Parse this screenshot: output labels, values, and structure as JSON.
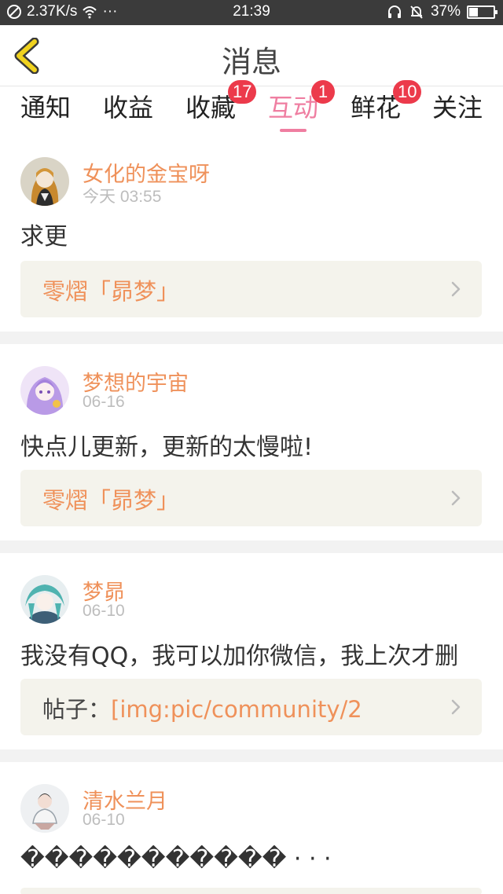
{
  "status_bar": {
    "net_speed": "2.37K/s",
    "dots": "···",
    "time": "21:39",
    "battery": "37%",
    "battery_level": 0.37
  },
  "header": {
    "title": "消息"
  },
  "tabs": [
    {
      "label": "通知",
      "badge": ""
    },
    {
      "label": "收益",
      "badge": ""
    },
    {
      "label": "收藏",
      "badge": "17"
    },
    {
      "label": "互动",
      "badge": "1",
      "active": true
    },
    {
      "label": "鲜花",
      "badge": "10"
    },
    {
      "label": "关注",
      "badge": ""
    }
  ],
  "messages": [
    {
      "user": "女化的金宝呀",
      "time": "今天 03:55",
      "text": "求更",
      "ref_prefix": "",
      "ref_title": "零熠「昴梦」",
      "avatar_icon": "user-avatar-icon"
    },
    {
      "user": "梦想的宇宙",
      "time": "06-16",
      "text": "快点儿更新，更新的太慢啦!",
      "ref_prefix": "",
      "ref_title": "零熠「昴梦」",
      "avatar_icon": "user-avatar-icon"
    },
    {
      "user": "梦昴",
      "time": "06-10",
      "text": "我没有QQ，我可以加你微信，我上次才删",
      "ref_prefix": "帖子：",
      "ref_title": "[img:pic/community/2",
      "avatar_icon": "user-avatar-icon"
    },
    {
      "user": "清水兰月",
      "time": "06-10",
      "text": "����������� · · ·",
      "ref_prefix": "",
      "ref_title": "",
      "avatar_icon": "user-avatar-icon"
    }
  ],
  "colors": {
    "accent_pink": "#ef7ea1",
    "name_orange": "#ef915a",
    "badge_red": "#ec3a4b",
    "back_yellow": "#e6c200"
  }
}
